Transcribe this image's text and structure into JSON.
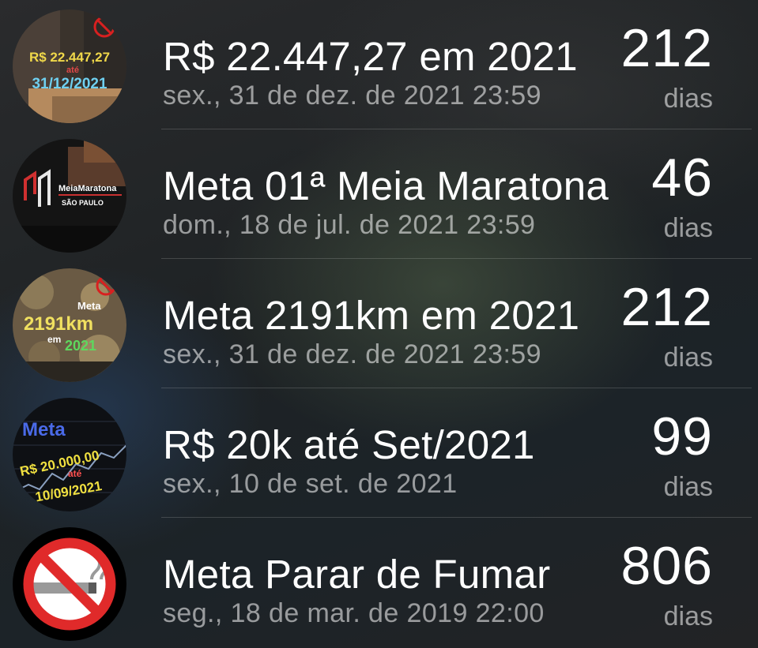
{
  "countdowns": [
    {
      "title": "R$ 22.447,27 em 2021",
      "date": "sex., 31 de dez. de 2021 23:59",
      "count": "212",
      "unit": "dias",
      "thumbnail": {
        "icon": "money-goal-image",
        "line1": "R$ 22.447,27",
        "line2": "até",
        "line3": "31/12/2021"
      }
    },
    {
      "title": "Meta 01ª Meia Maratona",
      "date": "dom., 18 de jul. de 2021 23:59",
      "count": "46",
      "unit": "dias",
      "thumbnail": {
        "icon": "half-marathon-image",
        "line1": "MeiaMaratona",
        "line2": "SÃO PAULO"
      }
    },
    {
      "title": "Meta 2191km em 2021",
      "date": "sex., 31 de dez. de 2021 23:59",
      "count": "212",
      "unit": "dias",
      "thumbnail": {
        "icon": "km-goal-image",
        "line1": "Meta",
        "line2": "2191km",
        "line3": "em",
        "line4": "2021"
      }
    },
    {
      "title": "R$ 20k até Set/2021",
      "date": "sex., 10 de set. de 2021",
      "count": "99",
      "unit": "dias",
      "thumbnail": {
        "icon": "savings-goal-image",
        "line1": "Meta",
        "line2": "R$ 20.000,00",
        "line3": "até",
        "line4": "10/09/2021"
      }
    },
    {
      "title": "Meta Parar de Fumar",
      "date": "seg., 18 de mar. de 2019 22:00",
      "count": "806",
      "unit": "dias",
      "thumbnail": {
        "icon": "no-smoking-icon"
      }
    }
  ]
}
